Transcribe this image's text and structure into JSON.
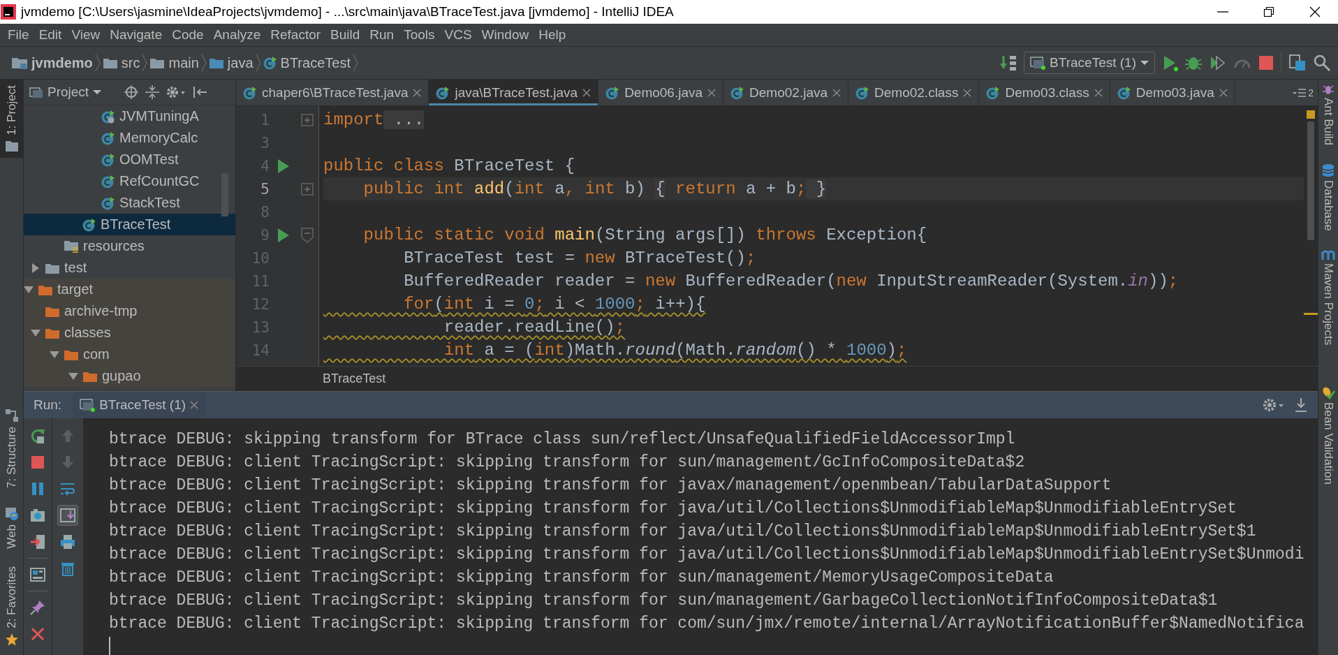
{
  "window": {
    "title": "jvmdemo [C:\\Users\\jasmine\\IdeaProjects\\jvmdemo] - ...\\src\\main\\java\\BTraceTest.java [jvmdemo] - IntelliJ IDEA"
  },
  "menu": [
    "File",
    "Edit",
    "View",
    "Navigate",
    "Code",
    "Analyze",
    "Refactor",
    "Build",
    "Run",
    "Tools",
    "VCS",
    "Window",
    "Help"
  ],
  "breadcrumbs": [
    {
      "label": "jvmdemo",
      "kind": "module"
    },
    {
      "label": "src",
      "kind": "folder"
    },
    {
      "label": "main",
      "kind": "folder"
    },
    {
      "label": "java",
      "kind": "source"
    },
    {
      "label": "BTraceTest",
      "kind": "class"
    }
  ],
  "run_config": "BTraceTest (1)",
  "left_tool_windows": [
    {
      "label": "1: Project",
      "selected": true,
      "kind": "project"
    },
    {
      "label": "7: Structure",
      "selected": false,
      "kind": "structure"
    },
    {
      "label": "Web",
      "selected": false,
      "kind": "web"
    },
    {
      "label": "2: Favorites",
      "selected": false,
      "kind": "favorites"
    }
  ],
  "right_tool_windows": [
    {
      "label": "Ant Build",
      "kind": "ant"
    },
    {
      "label": "Database",
      "kind": "database"
    },
    {
      "label": "Maven Projects",
      "kind": "maven"
    },
    {
      "label": "Bean Validation",
      "kind": "bean"
    }
  ],
  "project_panel": {
    "title": "Project",
    "tree": [
      {
        "children": [
          {
            "children": [
              {
                "children": [
                  {
                    "children": [
                      {
                        "label": "JVMTuningA",
                        "kind": "class-spring",
                        "selected": false
                      },
                      {
                        "label": "MemoryCalc",
                        "kind": "class",
                        "selected": false
                      },
                      {
                        "label": "OOMTest",
                        "kind": "class",
                        "selected": false
                      },
                      {
                        "label": "RefCountGC",
                        "kind": "class",
                        "selected": false
                      },
                      {
                        "label": "StackTest",
                        "kind": "class",
                        "selected": false
                      }
                    ]
                  },
                  {
                    "label": "BTraceTest",
                    "kind": "class",
                    "selected": true
                  }
                ]
              },
              {
                "label": "resources",
                "kind": "resources",
                "selected": false
              }
            ]
          },
          {
            "label": "test",
            "kind": "folder",
            "selected": false,
            "expanded": false
          }
        ]
      },
      {
        "label": "target",
        "kind": "excluded",
        "selected": false,
        "expanded": true,
        "children": [
          {
            "label": "archive-tmp",
            "kind": "excluded",
            "selected": false
          },
          {
            "label": "classes",
            "kind": "excluded",
            "selected": false,
            "expanded": true,
            "children": [
              {
                "label": "com",
                "kind": "excluded",
                "selected": false,
                "expanded": true,
                "children": [
                  {
                    "label": "gupao",
                    "kind": "excluded",
                    "selected": false,
                    "expanded": true
                  }
                ]
              }
            ]
          }
        ]
      }
    ]
  },
  "editor": {
    "tabs": [
      {
        "label": "chaper6\\BTraceTest.java",
        "selected": false
      },
      {
        "label": "java\\BTraceTest.java",
        "selected": true
      },
      {
        "label": "Demo06.java",
        "selected": false
      },
      {
        "label": "Demo02.java",
        "selected": false
      },
      {
        "label": "Demo02.class",
        "selected": false
      },
      {
        "label": "Demo03.class",
        "selected": false
      },
      {
        "label": "Demo03.java",
        "selected": false
      }
    ],
    "hidden_tabs": "2",
    "lines": [
      {
        "number": "1",
        "run": false,
        "collapsed": true,
        "current": false,
        "warning": false,
        "tokens": [
          {
            "text": "import",
            "kind": "keyword"
          },
          {
            "text": " ...",
            "kind": "folded"
          }
        ]
      },
      {
        "number": "3",
        "run": false,
        "current": false
      },
      {
        "number": "4",
        "run": true,
        "current": false,
        "warning": false,
        "tokens": [
          {
            "text": "public class",
            "kind": "keyword"
          },
          {
            "text": " BTraceTest {",
            "kind": "plain"
          }
        ]
      },
      {
        "number": "5",
        "run": false,
        "collapsed": true,
        "current": true,
        "warning": false,
        "tokens": [
          {
            "text": "    public int",
            "kind": "keyword"
          },
          {
            "text": " add",
            "kind": "method"
          },
          {
            "text": "(",
            "kind": "plain"
          },
          {
            "text": "int",
            "kind": "keyword"
          },
          {
            "text": " a",
            "kind": "plain"
          },
          {
            "text": ",",
            "kind": "keyword"
          },
          {
            "text": " int",
            "kind": "keyword"
          },
          {
            "text": " b) ",
            "kind": "plain"
          },
          {
            "text": "{",
            "kind": "folded"
          },
          {
            "text": " return",
            "kind": "keyword"
          },
          {
            "text": " a + b",
            "kind": "plain"
          },
          {
            "text": ";",
            "kind": "keyword"
          },
          {
            "text": " }",
            "kind": "folded"
          }
        ]
      },
      {
        "number": "8",
        "run": false,
        "current": false
      },
      {
        "number": "9",
        "run": true,
        "collapsed": false,
        "current": false,
        "warning": false,
        "tokens": [
          {
            "text": "    public static void",
            "kind": "keyword"
          },
          {
            "text": " main",
            "kind": "method"
          },
          {
            "text": "(String args[]) ",
            "kind": "plain"
          },
          {
            "text": "throws",
            "kind": "keyword"
          },
          {
            "text": " Exception{",
            "kind": "plain"
          }
        ]
      },
      {
        "number": "10",
        "run": false,
        "current": false,
        "warning": false,
        "tokens": [
          {
            "text": "        BTraceTest test = ",
            "kind": "plain"
          },
          {
            "text": "new",
            "kind": "keyword"
          },
          {
            "text": " BTraceTest()",
            "kind": "plain"
          },
          {
            "text": ";",
            "kind": "keyword"
          }
        ]
      },
      {
        "number": "11",
        "run": false,
        "current": false,
        "warning": false,
        "tokens": [
          {
            "text": "        BufferedReader reader = ",
            "kind": "plain"
          },
          {
            "text": "new",
            "kind": "keyword"
          },
          {
            "text": " BufferedReader(",
            "kind": "plain"
          },
          {
            "text": "new",
            "kind": "keyword"
          },
          {
            "text": " InputStreamReader(System.",
            "kind": "plain"
          },
          {
            "text": "in",
            "kind": "field"
          },
          {
            "text": "))",
            "kind": "plain"
          },
          {
            "text": ";",
            "kind": "keyword"
          }
        ]
      },
      {
        "number": "12",
        "run": false,
        "current": false,
        "warning": true,
        "tokens": [
          {
            "text": "        for",
            "kind": "keyword"
          },
          {
            "text": "(",
            "kind": "plain"
          },
          {
            "text": "int",
            "kind": "keyword"
          },
          {
            "text": " i = ",
            "kind": "plain"
          },
          {
            "text": "0",
            "kind": "number"
          },
          {
            "text": ";",
            "kind": "keyword"
          },
          {
            "text": " i < ",
            "kind": "plain"
          },
          {
            "text": "1000",
            "kind": "number"
          },
          {
            "text": ";",
            "kind": "keyword"
          },
          {
            "text": " i++){",
            "kind": "plain"
          }
        ]
      },
      {
        "number": "13",
        "run": false,
        "current": false,
        "warning": true,
        "tokens": [
          {
            "text": "            reader.readLine()",
            "kind": "plain"
          },
          {
            "text": ";",
            "kind": "keyword"
          }
        ]
      },
      {
        "number": "14",
        "run": false,
        "current": false,
        "warning": true,
        "tokens": [
          {
            "text": "            int",
            "kind": "keyword"
          },
          {
            "text": " a = (",
            "kind": "plain"
          },
          {
            "text": "int",
            "kind": "keyword"
          },
          {
            "text": ")Math.",
            "kind": "plain"
          },
          {
            "text": "round",
            "kind": "static-method"
          },
          {
            "text": "(Math.",
            "kind": "plain"
          },
          {
            "text": "random",
            "kind": "static-method"
          },
          {
            "text": "() * ",
            "kind": "plain"
          },
          {
            "text": "1000",
            "kind": "number"
          },
          {
            "text": ")",
            "kind": "plain"
          },
          {
            "text": ";",
            "kind": "keyword"
          }
        ]
      }
    ],
    "breadcrumb": "BTraceTest"
  },
  "run": {
    "label": "Run:",
    "tab": "BTraceTest (1)",
    "console": [
      "btrace DEBUG: skipping transform for BTrace class sun/reflect/UnsafeQualifiedFieldAccessorImpl",
      "btrace DEBUG: client TracingScript: skipping transform for sun/management/GcInfoCompositeData$2",
      "btrace DEBUG: client TracingScript: skipping transform for javax/management/openmbean/TabularDataSupport",
      "btrace DEBUG: client TracingScript: skipping transform for java/util/Collections$UnmodifiableMap$UnmodifiableEntrySet",
      "btrace DEBUG: client TracingScript: skipping transform for java/util/Collections$UnmodifiableMap$UnmodifiableEntrySet$1",
      "btrace DEBUG: client TracingScript: skipping transform for java/util/Collections$UnmodifiableMap$UnmodifiableEntrySet$Unmodi",
      "btrace DEBUG: client TracingScript: skipping transform for sun/management/MemoryUsageCompositeData",
      "btrace DEBUG: client TracingScript: skipping transform for sun/management/GarbageCollectionNotifInfoCompositeData$1",
      "btrace DEBUG: client TracingScript: skipping transform for com/sun/jmx/remote/internal/ArrayNotificationBuffer$NamedNotifica"
    ]
  }
}
